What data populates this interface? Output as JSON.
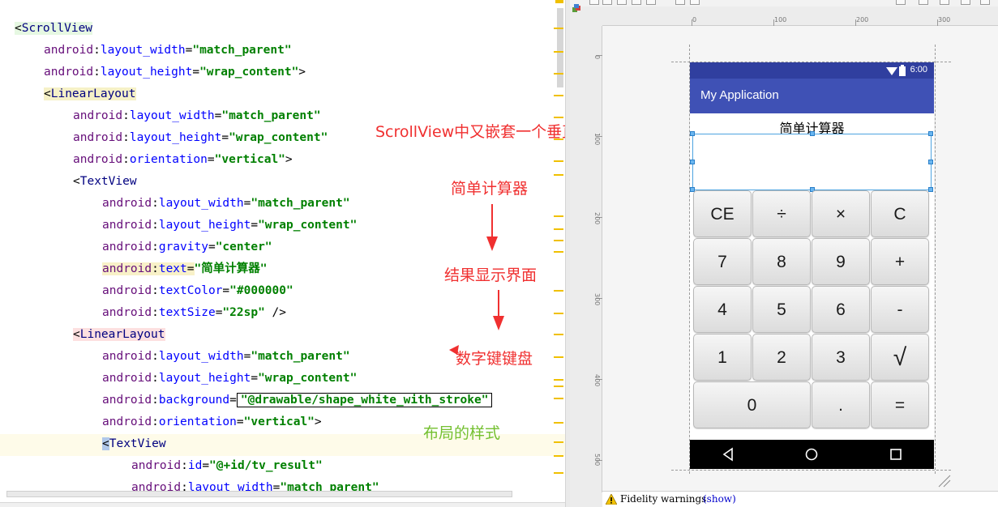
{
  "editor": {
    "lines": [
      {
        "tag": "<ScrollView"
      },
      {
        "ns": "android",
        "attr": "layout_width",
        "val": "\"match_parent\""
      },
      {
        "ns": "android",
        "attr": "layout_height",
        "val": "\"wrap_content\"",
        "end": ">"
      },
      {
        "tag": "<LinearLayout"
      },
      {
        "ns": "android",
        "attr": "layout_width",
        "val": "\"match_parent\""
      },
      {
        "ns": "android",
        "attr": "layout_height",
        "val": "\"wrap_content\""
      },
      {
        "ns": "android",
        "attr": "orientation",
        "val": "\"vertical\"",
        "end": ">"
      },
      {
        "tag": "<TextView"
      },
      {
        "ns": "android",
        "attr": "layout_width",
        "val": "\"match_parent\""
      },
      {
        "ns": "android",
        "attr": "layout_height",
        "val": "\"wrap_content\""
      },
      {
        "ns": "android",
        "attr": "gravity",
        "val": "\"center\""
      },
      {
        "ns": "android",
        "attr": "text",
        "val": "\"简单计算器\""
      },
      {
        "ns": "android",
        "attr": "textColor",
        "val": "\"#000000\""
      },
      {
        "ns": "android",
        "attr": "textSize",
        "val": "\"22sp\"",
        "end": " />"
      },
      {
        "tag": "<LinearLayout"
      },
      {
        "ns": "android",
        "attr": "layout_width",
        "val": "\"match_parent\""
      },
      {
        "ns": "android",
        "attr": "layout_height",
        "val": "\"wrap_content\""
      },
      {
        "ns": "android",
        "attr": "background",
        "val": "\"@drawable/shape_white_with_stroke\""
      },
      {
        "ns": "android",
        "attr": "orientation",
        "val": "\"vertical\"",
        "end": ">"
      },
      {
        "tag": "<TextView"
      },
      {
        "ns": "android",
        "attr": "id",
        "val": "\"@+id/tv_result\""
      },
      {
        "ns": "android",
        "attr": "layout_width",
        "val": "\"match_parent\""
      }
    ]
  },
  "annotations": {
    "scrollview_note": "ScrollView中又嵌套一个垂直线性布局",
    "title_note": "简单计算器",
    "result_note": "结果显示界面",
    "keypad_note": "数字键键盘",
    "style_note": "布局的样式"
  },
  "design": {
    "ruler_h": [
      "0",
      "100",
      "200",
      "300"
    ],
    "ruler_v": [
      "0",
      "100",
      "200",
      "300",
      "400",
      "500"
    ],
    "status_time": "6:00",
    "app_title": "My Application",
    "calc_title": "简单计算器",
    "keys": [
      "CE",
      "÷",
      "×",
      "C",
      "7",
      "8",
      "9",
      "+",
      "4",
      "5",
      "6",
      "-",
      "1",
      "2",
      "3",
      "√",
      "0",
      ".",
      "="
    ],
    "fidelity_text": "Fidelity warnings",
    "fidelity_link": "(show)"
  },
  "colors": {
    "status_bar": "#303f9f",
    "app_bar": "#3f51b5",
    "annotation": "#f03030",
    "annotation_green": "#74c030"
  },
  "icons": {
    "wifi": "wifi-icon",
    "battery": "battery-icon",
    "back": "nav-back-icon",
    "home": "nav-home-icon",
    "recents": "nav-recents-icon",
    "warning": "warning-icon"
  }
}
